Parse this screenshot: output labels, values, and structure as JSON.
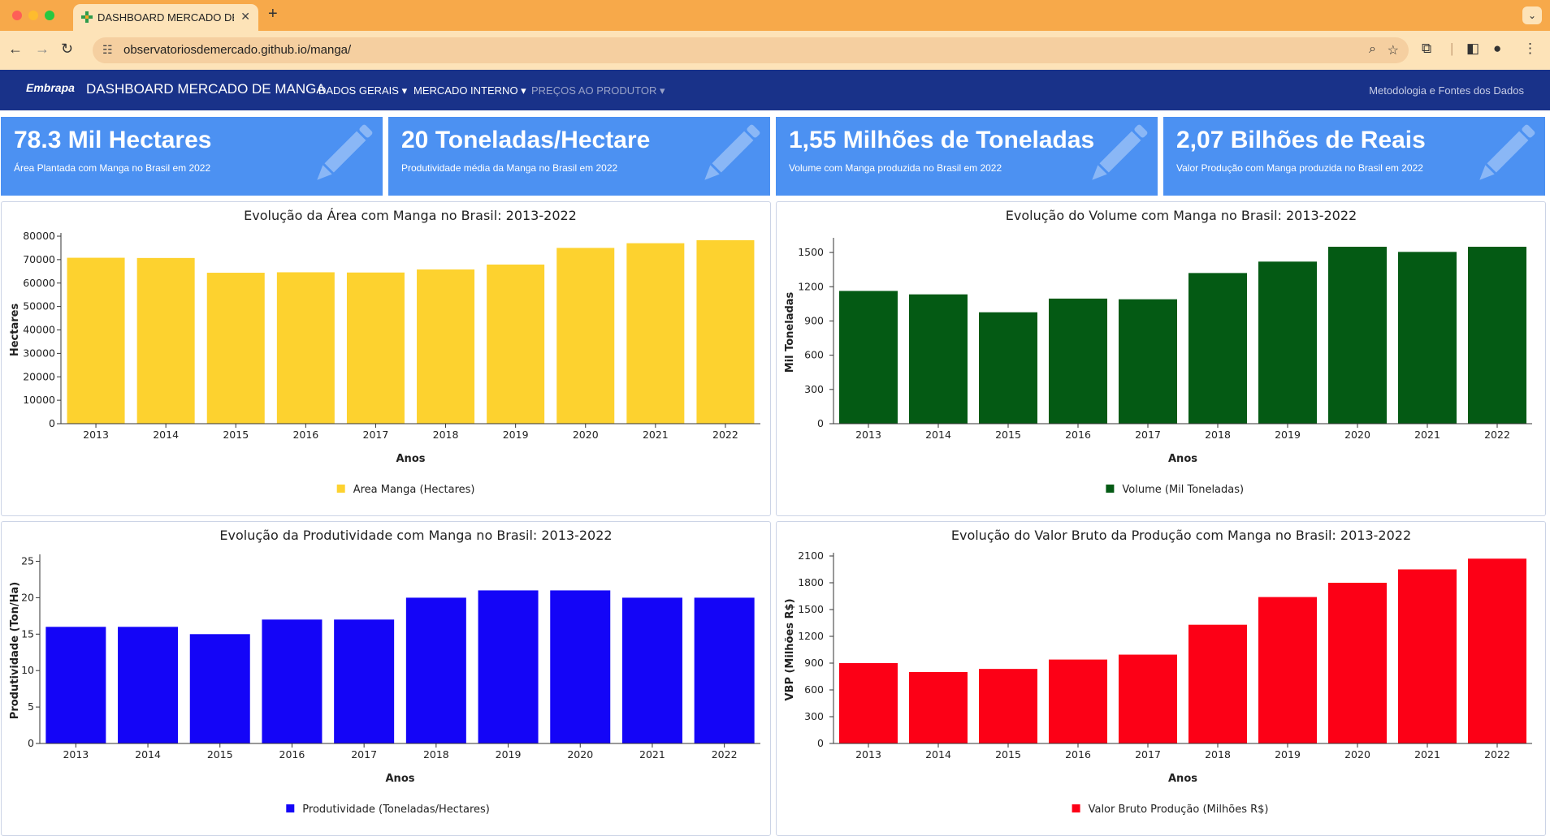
{
  "browser": {
    "tab_title": "DASHBOARD MERCADO DE M",
    "url": "observatoriosdemercado.github.io/manga/",
    "new_tab_label": "+",
    "tab_close_label": "✕",
    "tab_menu_label": "⌄"
  },
  "navbar": {
    "logo": "Embrapa",
    "title": "DASHBOARD MERCADO DE MANGA",
    "menu": [
      {
        "label": "DADOS GERAIS ▾"
      },
      {
        "label": "MERCADO INTERNO ▾"
      },
      {
        "label": "PREÇOS AO PRODUTOR ▾"
      }
    ],
    "right_link": "Metodologia e Fontes dos Dados"
  },
  "cards": [
    {
      "value": "78.3 Mil Hectares",
      "label": "Área Plantada com Manga no Brasil em 2022",
      "icon": "pencil-icon"
    },
    {
      "value": "20 Toneladas/Hectare",
      "label": "Produtividade média da Manga no Brasil em 2022",
      "icon": "pencil-icon"
    },
    {
      "value": "1,55 Milhões de Toneladas",
      "label": "Volume com Manga produzida no Brasil em 2022",
      "icon": "pencil-icon"
    },
    {
      "value": "2,07 Bilhões de Reais",
      "label": "Valor Produção com Manga produzida no Brasil em 2022",
      "icon": "pencil-icon"
    }
  ],
  "chart_data": [
    {
      "type": "bar",
      "title": "Evolução da Área com Manga no Brasil: 2013-2022",
      "xlabel": "Anos",
      "ylabel": "Hectares",
      "categories": [
        "2013",
        "2014",
        "2015",
        "2016",
        "2017",
        "2018",
        "2019",
        "2020",
        "2021",
        "2022"
      ],
      "series": [
        {
          "name": "Area Manga (Hectares)",
          "values": [
            70800,
            70700,
            64400,
            64600,
            64500,
            65800,
            67900,
            75000,
            77000,
            78300
          ]
        }
      ],
      "color": "#fdd22f",
      "ylim": [
        0,
        80000
      ],
      "yticks": [
        0,
        10000,
        20000,
        30000,
        40000,
        50000,
        60000,
        70000,
        80000
      ],
      "grid": false,
      "legend": "bottom-center"
    },
    {
      "type": "bar",
      "title": "Evolução do Volume com Manga no Brasil: 2013-2022",
      "xlabel": "Anos",
      "ylabel": "Mil Toneladas",
      "categories": [
        "2013",
        "2014",
        "2015",
        "2016",
        "2017",
        "2018",
        "2019",
        "2020",
        "2021",
        "2022"
      ],
      "series": [
        {
          "name": "Volume (Mil Toneladas)",
          "values": [
            1163,
            1133,
            976,
            1096,
            1090,
            1320,
            1420,
            1550,
            1505,
            1550
          ]
        }
      ],
      "color": "#045a14",
      "ylim": [
        0,
        1600
      ],
      "yticks": [
        0,
        300,
        600,
        900,
        1200,
        1500
      ],
      "grid": false,
      "legend": "bottom-center"
    },
    {
      "type": "bar",
      "title": "Evolução da Produtividade com Manga no Brasil: 2013-2022",
      "xlabel": "Anos",
      "ylabel": "Produtividade (Ton/Ha)",
      "categories": [
        "2013",
        "2014",
        "2015",
        "2016",
        "2017",
        "2018",
        "2019",
        "2020",
        "2021",
        "2022"
      ],
      "series": [
        {
          "name": "Produtividade (Toneladas/Hectares)",
          "values": [
            16,
            16,
            15,
            17,
            17,
            20,
            21,
            21,
            20,
            20
          ]
        }
      ],
      "color": "#1405f7",
      "ylim": [
        0,
        25.5
      ],
      "yticks": [
        0,
        5,
        10,
        15,
        20,
        25
      ],
      "grid": false,
      "legend": "bottom-center"
    },
    {
      "type": "bar",
      "title": "Evolução do Valor Bruto da Produção com Manga no Brasil: 2013-2022",
      "xlabel": "Anos",
      "ylabel": "VBP (Milhões R$)",
      "categories": [
        "2013",
        "2014",
        "2015",
        "2016",
        "2017",
        "2018",
        "2019",
        "2020",
        "2021",
        "2022"
      ],
      "series": [
        {
          "name": "Valor Bruto Produção (Milhões R$)",
          "values": [
            900,
            800,
            835,
            940,
            995,
            1330,
            1640,
            1800,
            1950,
            2070
          ]
        }
      ],
      "color": "#fc0016",
      "ylim": [
        0,
        2100
      ],
      "yticks": [
        0,
        300,
        600,
        900,
        1200,
        1500,
        1800,
        2100
      ],
      "grid": false,
      "legend": "bottom-center"
    }
  ]
}
